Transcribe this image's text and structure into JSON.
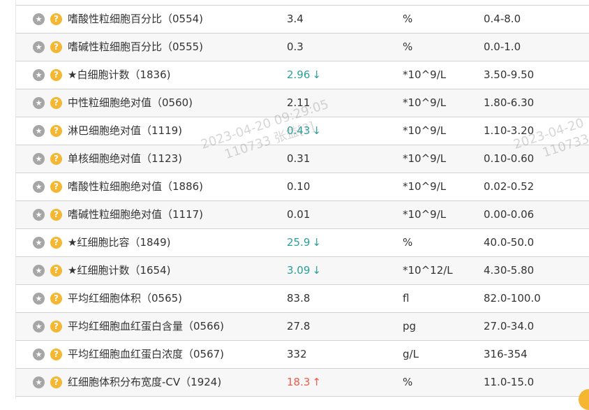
{
  "rows": [
    {
      "name": "嗜酸性粒细胞百分比（0554)",
      "value": "3.4",
      "flag": "",
      "unit": "%",
      "range": "0.4-8.0"
    },
    {
      "name": "嗜碱性粒细胞百分比（0555)",
      "value": "0.3",
      "flag": "",
      "unit": "%",
      "range": "0.0-1.0"
    },
    {
      "name": "★白细胞计数（1836)",
      "value": "2.96",
      "flag": "low",
      "unit": "*10^9/L",
      "range": "3.50-9.50"
    },
    {
      "name": "中性粒细胞绝对值（0560)",
      "value": "2.11",
      "flag": "",
      "unit": "*10^9/L",
      "range": "1.80-6.30"
    },
    {
      "name": "淋巴细胞绝对值（1119)",
      "value": "0.43",
      "flag": "low",
      "unit": "*10^9/L",
      "range": "1.10-3.20"
    },
    {
      "name": "单核细胞绝对值（1123)",
      "value": "0.31",
      "flag": "",
      "unit": "*10^9/L",
      "range": "0.10-0.60"
    },
    {
      "name": "嗜酸性粒细胞绝对值（1886)",
      "value": "0.10",
      "flag": "",
      "unit": "*10^9/L",
      "range": "0.02-0.52"
    },
    {
      "name": "嗜碱性粒细胞绝对值（1117)",
      "value": "0.01",
      "flag": "",
      "unit": "*10^9/L",
      "range": "0.00-0.06"
    },
    {
      "name": "★红细胞比容（1849)",
      "value": "25.9",
      "flag": "low",
      "unit": "%",
      "range": "40.0-50.0"
    },
    {
      "name": "★红细胞计数（1654)",
      "value": "3.09",
      "flag": "low",
      "unit": "*10^12/L",
      "range": "4.30-5.80"
    },
    {
      "name": "平均红细胞体积（0565)",
      "value": "83.8",
      "flag": "",
      "unit": "fl",
      "range": "82.0-100.0"
    },
    {
      "name": "平均红细胞血红蛋白含量（0566)",
      "value": "27.8",
      "flag": "",
      "unit": "pg",
      "range": "27.0-34.0"
    },
    {
      "name": "平均红细胞血红蛋白浓度（0567)",
      "value": "332",
      "flag": "",
      "unit": "g/L",
      "range": "316-354"
    },
    {
      "name": "红细胞体积分布宽度-CV（1924)",
      "value": "18.3",
      "flag": "high",
      "unit": "%",
      "range": "11.0-15.0"
    }
  ],
  "arrows": {
    "low": "↓",
    "high": "↑"
  },
  "icons": {
    "star": "star-icon",
    "help": "help-icon"
  },
  "icon_glyphs": {
    "star": "★",
    "help": "?"
  },
  "colors": {
    "low": "#2aa198",
    "high": "#ef5b4b",
    "help_icon": "#f5b731",
    "star_icon": "#a6a6a6"
  },
  "watermarks": [
    {
      "line1": "2023-04-20 09:29:05",
      "line2": "110733 张益[?]"
    },
    {
      "line1": "2023-04-20",
      "line2": "110733"
    }
  ]
}
